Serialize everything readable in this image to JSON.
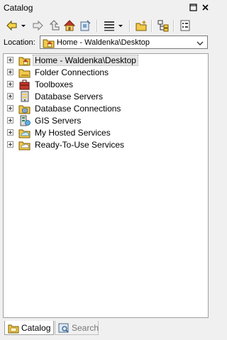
{
  "window": {
    "title": "Catalog"
  },
  "location": {
    "label": "Location:",
    "value": "Home - Waldenka\\Desktop"
  },
  "tree": {
    "items": [
      {
        "label": "Home - Waldenka\\Desktop",
        "icon": "home-folder-icon",
        "selected": true
      },
      {
        "label": "Folder Connections",
        "icon": "folder-connections-icon"
      },
      {
        "label": "Toolboxes",
        "icon": "toolbox-icon"
      },
      {
        "label": "Database Servers",
        "icon": "database-server-icon"
      },
      {
        "label": "Database Connections",
        "icon": "database-connections-icon"
      },
      {
        "label": "GIS Servers",
        "icon": "gis-server-icon"
      },
      {
        "label": "My Hosted Services",
        "icon": "hosted-services-icon"
      },
      {
        "label": "Ready-To-Use Services",
        "icon": "ready-to-use-services-icon"
      }
    ]
  },
  "tabs": [
    {
      "label": "Catalog",
      "active": true
    },
    {
      "label": "Search",
      "active": false
    }
  ]
}
